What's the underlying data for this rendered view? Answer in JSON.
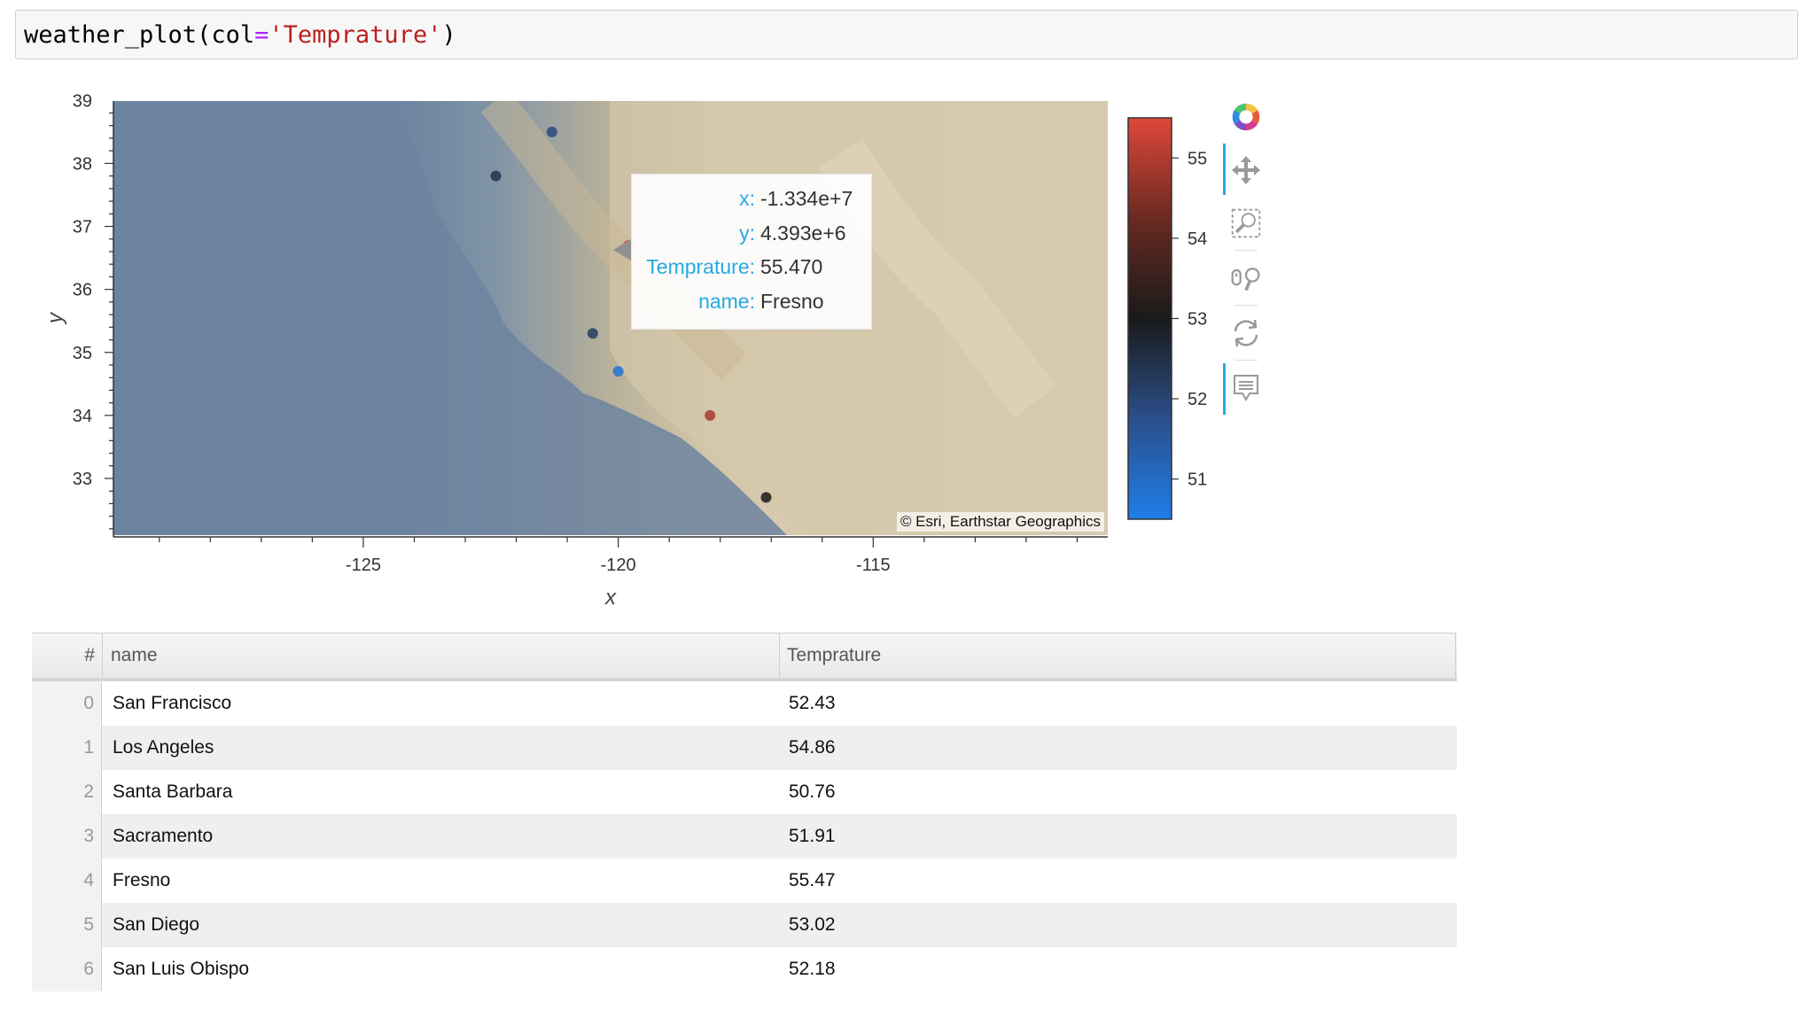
{
  "code_cell": {
    "fn": "weather_plot",
    "open": "(",
    "param": "col",
    "op": "=",
    "arg": "'Temprature'",
    "close": ")"
  },
  "plot": {
    "attribution": "© Esri, Earthstar Geographics",
    "tooltip": {
      "rows": [
        {
          "key": "x:",
          "value": "-1.334e+7"
        },
        {
          "key": "y:",
          "value": "4.393e+6"
        },
        {
          "key": "Temprature:",
          "value": "55.470"
        },
        {
          "key": "name:",
          "value": "Fresno"
        }
      ]
    },
    "toolbar": [
      "bokeh-logo-icon",
      "pan-icon",
      "box-zoom-icon",
      "wheel-zoom-icon",
      "reset-icon",
      "hover-icon"
    ]
  },
  "chart_data": {
    "type": "scatter",
    "xlabel": "x",
    "ylabel": "y",
    "xlim": [
      -129.9,
      -110.4
    ],
    "ylim": [
      32.1,
      38.99
    ],
    "xticks": [
      -125,
      -120,
      -115
    ],
    "yticks": [
      33,
      34,
      35,
      36,
      37,
      38,
      39
    ],
    "points": [
      {
        "x": -121.3,
        "y": 38.5,
        "temp": 51.91
      },
      {
        "x": -122.4,
        "y": 37.8,
        "temp": 52.43
      },
      {
        "x": -119.8,
        "y": 36.7,
        "temp": 55.47
      },
      {
        "x": -120.5,
        "y": 35.3,
        "temp": 52.18
      },
      {
        "x": -120.0,
        "y": 34.7,
        "temp": 50.76
      },
      {
        "x": -118.2,
        "y": 34.0,
        "temp": 54.86
      },
      {
        "x": -117.1,
        "y": 32.7,
        "temp": 53.02
      }
    ],
    "colorbar": {
      "ticks": [
        55,
        54,
        53,
        52,
        51
      ],
      "range": [
        50.5,
        55.5
      ],
      "colors": [
        "#1f7de8",
        "#2b4f8a",
        "#1a1a1a",
        "#6a2a22",
        "#e0473a"
      ]
    }
  },
  "table": {
    "headers": {
      "index": "#",
      "name": "name",
      "temp": "Temprature"
    },
    "rows": [
      {
        "idx": "0",
        "name": "San Francisco",
        "temp": "52.43"
      },
      {
        "idx": "1",
        "name": "Los Angeles",
        "temp": "54.86"
      },
      {
        "idx": "2",
        "name": "Santa Barbara",
        "temp": "50.76"
      },
      {
        "idx": "3",
        "name": "Sacramento",
        "temp": "51.91"
      },
      {
        "idx": "4",
        "name": "Fresno",
        "temp": "55.47"
      },
      {
        "idx": "5",
        "name": "San Diego",
        "temp": "53.02"
      },
      {
        "idx": "6",
        "name": "San Luis Obispo",
        "temp": "52.18"
      }
    ]
  }
}
